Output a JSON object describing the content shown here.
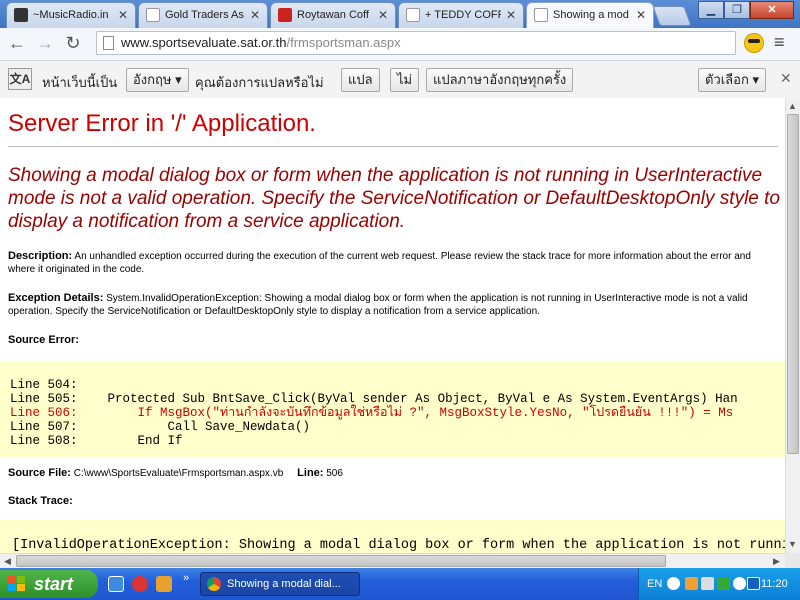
{
  "browser": {
    "tabs": [
      {
        "title": "~MusicRadio.in",
        "favicon_color": "#333333"
      },
      {
        "title": "Gold Traders As",
        "favicon_color": "#ffffff"
      },
      {
        "title": "Roytawan Coff",
        "favicon_color": "#cc2222"
      },
      {
        "title": "+ TEDDY COFFI",
        "favicon_color": "#ffffff"
      },
      {
        "title": "Showing a mod",
        "favicon_color": "#ffffff"
      }
    ],
    "active_tab_index": 4,
    "url_domain": "www.sportsevaluate.sat.or.th",
    "url_path": "/frmsportsman.aspx",
    "icons": {
      "back": "back-arrow-icon",
      "forward": "forward-arrow-icon",
      "reload": "reload-icon",
      "star": "star-icon",
      "menu": "menu-icon"
    }
  },
  "translate_bar": {
    "text1": "หน้าเว็บนี้เป็น",
    "language": "อังกฤษ ▾",
    "text2": "คุณต้องการแปลหรือไม่",
    "translate": "แปล",
    "no": "ไม่",
    "always": "แปลภาษาอังกฤษทุกครั้ง",
    "options": "ตัวเลือก ▾",
    "close": "✕"
  },
  "page": {
    "title": "Server Error in '/' Application.",
    "error_message": "Showing a modal dialog box or form when the application is not running in UserInteractive mode is not a valid operation. Specify the ServiceNotification or DefaultDesktopOnly style to display a notification from a service application.",
    "description_label": "Description:",
    "description_text": " An unhandled exception occurred during the execution of the current web request. Please review the stack trace for more information about the error and where it originated in the code.",
    "exception_label": "Exception Details:",
    "exception_text": " System.InvalidOperationException: Showing a modal dialog box or form when the application is not running in UserInteractive mode is not a valid operation. Specify the ServiceNotification or DefaultDesktopOnly style to display a notification from a service application.",
    "source_error_label": "Source Error:",
    "code_lines": [
      {
        "text": "Line 504:",
        "error": false
      },
      {
        "text": "Line 505:    Protected Sub BntSave_Click(ByVal sender As Object, ByVal e As System.EventArgs) Han",
        "error": false
      },
      {
        "text": "Line 506:        If MsgBox(\"ท่านกำลังจะบันทึกข้อมูลใช่หรือไม่ ?\", MsgBoxStyle.YesNo, \"โปรดยืนยัน !!!\") = Ms",
        "error": true
      },
      {
        "text": "Line 507:            Call Save_Newdata()",
        "error": false
      },
      {
        "text": "Line 508:        End If",
        "error": false
      }
    ],
    "source_file_label": "Source File:",
    "source_file": " C:\\www\\SportsEvaluate\\Frmsportsman.aspx.vb",
    "line_label": "Line:",
    "line_value": " 506",
    "stack_trace_label": "Stack Trace:",
    "stack_line": "[InvalidOperationException: Showing a modal dialog box or form when the application is not runnin"
  },
  "taskbar": {
    "start": "start",
    "task_item": "Showing a modal dial...",
    "language": "EN",
    "clock": "11:20",
    "more": "»"
  }
}
